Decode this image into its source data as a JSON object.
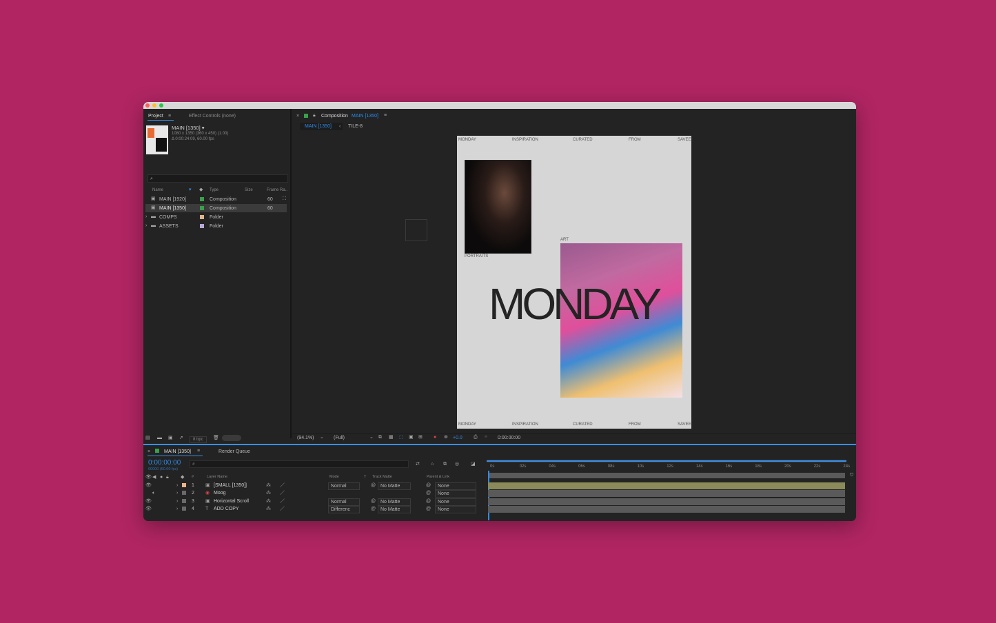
{
  "project_panel": {
    "tab_project": "Project",
    "tab_effect_controls": "Effect Controls (none)",
    "selected_name": "MAIN [1350] ▾",
    "selected_dims": "1080 x 1350  (360 x 450) (1.00)",
    "selected_duration": "Δ 0:00:24:09, 60.00 fps",
    "columns": {
      "name": "Name",
      "type": "Type",
      "size": "Size",
      "frame_rate": "Frame Ra.."
    },
    "items": [
      {
        "name": "MAIN [1920]",
        "type": "Composition",
        "frame_rate": "60",
        "color": "#3aa04a"
      },
      {
        "name": "MAIN [1350]",
        "type": "Composition",
        "frame_rate": "60",
        "color": "#3aa04a"
      },
      {
        "name": "COMPS",
        "type": "Folder",
        "frame_rate": "",
        "color": "#e0b48a"
      },
      {
        "name": "ASSETS",
        "type": "Folder",
        "frame_rate": "",
        "color": "#b8a8d8"
      }
    ],
    "bpc": "8 bpc"
  },
  "comp_panel": {
    "header_prefix": "Composition",
    "header_name": "MAIN [1350]",
    "breadcrumb_active": "MAIN [1350]",
    "breadcrumb_next": "TILE-8",
    "viewer": {
      "top_labels": [
        "MONDAY",
        "INSPIRATION",
        "CURATED",
        "FROM",
        "SAVEE"
      ],
      "bottom_labels": [
        "MONDAY",
        "INSPIRATION",
        "CURATED",
        "FROM",
        "SAVEE"
      ],
      "portraits_label": "PORTRAITS",
      "art_label": "ART",
      "big_word": "MONDAY"
    },
    "toolbar": {
      "zoom": "(94.1%)",
      "resolution": "(Full)",
      "exposure": "+0.0",
      "timecode": "0:00:00:00"
    }
  },
  "timeline": {
    "tab_main": "MAIN [1350]",
    "tab_render": "Render Queue",
    "timecode": "0:00:00:00",
    "frames": "00000 (60.00 fps)",
    "columns": {
      "layer_name": "Layer Name",
      "mode": "Mode",
      "t": "T",
      "track_matte": "Track Matte",
      "parent": "Parent & Link"
    },
    "ruler": [
      "0s",
      "02s",
      "04s",
      "06s",
      "08s",
      "10s",
      "12s",
      "14s",
      "16s",
      "18s",
      "20s",
      "22s",
      "24s"
    ],
    "layers": [
      {
        "num": "1",
        "name": "[SMALL [1350]]",
        "mode": "Normal",
        "matte": "No Matte",
        "parent": "None",
        "label": "#e8b48c"
      },
      {
        "num": "2",
        "name": "Moog",
        "mode": "",
        "matte": "",
        "parent": "None",
        "label": "#6a6a6a"
      },
      {
        "num": "3",
        "name": "Horizontal Scroll",
        "mode": "Normal",
        "matte": "No Matte",
        "parent": "None",
        "label": "#6a6a6a"
      },
      {
        "num": "4",
        "name": "ADD COPY",
        "mode": "Differenc",
        "matte": "No Matte",
        "parent": "None",
        "label": "#6a6a6a"
      }
    ]
  }
}
